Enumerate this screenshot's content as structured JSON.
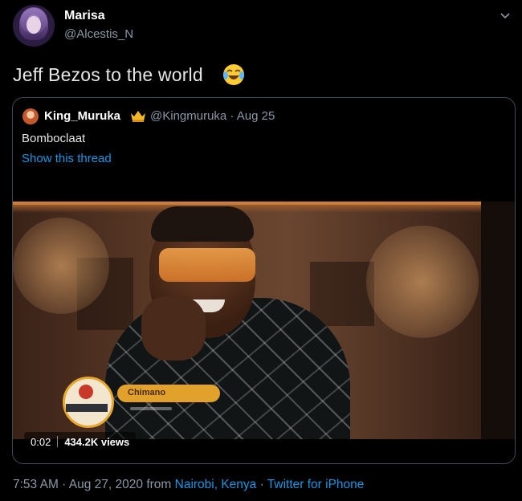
{
  "user": {
    "display_name": "Marisa",
    "handle": "@Alcestis_N",
    "avatar_icon": "avatar-photo"
  },
  "tweet": {
    "text": "Jeff Bezos to the world",
    "emoji": "face-with-tears-of-joy-emoji"
  },
  "quoted_tweet": {
    "display_name": "King_Muruka",
    "badge_icon": "crown-emoji",
    "meta": "@Kingmuruka · Aug 25",
    "text": "Bomboclaat",
    "show_thread_label": "Show this thread",
    "video": {
      "duration": "0:02",
      "views": "434.2K views",
      "lower_third_name": "Chimano"
    }
  },
  "footer": {
    "time_date": "7:53 AM · Aug 27, 2020 from ",
    "location": "Nairobi, Kenya",
    "separator": " · ",
    "source": "Twitter for iPhone"
  },
  "colors": {
    "background": "#000000",
    "link": "#1b95e0",
    "secondary_text": "#8899a6",
    "border": "#3d4a55"
  }
}
